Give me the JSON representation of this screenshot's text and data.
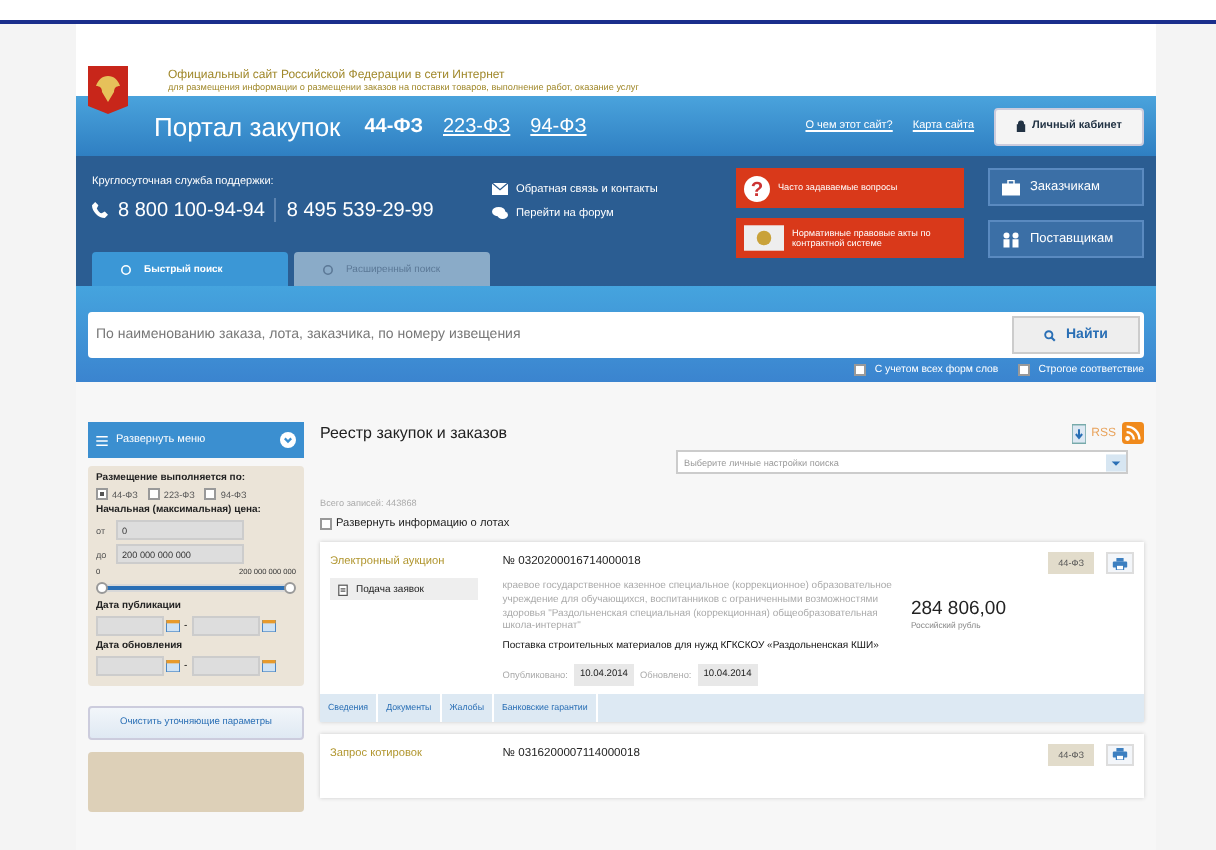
{
  "header": {
    "title": "Официальный сайт Российской Федерации в сети Интернет",
    "subtitle": "для размещения информации о размещении заказов на поставки товаров, выполнение работ, оказание услуг"
  },
  "nav": {
    "portal_title": "Портал закупок",
    "laws": [
      {
        "label": "44-ФЗ",
        "selected": true
      },
      {
        "label": "223-ФЗ",
        "selected": false
      },
      {
        "label": "94-ФЗ",
        "selected": false
      }
    ],
    "links": [
      "О чем этот сайт?",
      "Карта сайта"
    ],
    "cabinet_button": "Личный кабинет"
  },
  "support": {
    "label": "Круглосуточная служба поддержки:",
    "phones": [
      "8 800 100-94-94",
      "8 495 539-29-99"
    ]
  },
  "contact_links": [
    {
      "kind": "mail",
      "label": "Обратная связь и контакты"
    },
    {
      "kind": "forum",
      "label": "Перейти на форум"
    }
  ],
  "red_buttons": [
    {
      "kind": "faq",
      "icon": "?",
      "label": "Часто задаваемые вопросы"
    },
    {
      "kind": "law",
      "label": "Нормативные правовые акты по контрактной системе"
    }
  ],
  "blue_buttons": [
    {
      "kind": "customers",
      "label": "Заказчикам"
    },
    {
      "kind": "suppliers",
      "label": "Поставщикам"
    }
  ],
  "search_tabs": [
    {
      "label": "Быстрый поиск",
      "selected": true
    },
    {
      "label": "Расширенный поиск",
      "selected": false
    }
  ],
  "search": {
    "placeholder": "По наименованию заказа, лота, заказчика, по номеру извещения",
    "button": "Найти"
  },
  "search_options": [
    {
      "label": "С учетом всех форм слов",
      "checked": false
    },
    {
      "label": "Строгое соответствие",
      "checked": false
    }
  ],
  "sidebar": {
    "menu_button": "Развернуть меню",
    "placement_label": "Размещение выполняется по:",
    "laws": [
      {
        "label": "44-ФЗ",
        "checked": true
      },
      {
        "label": "223-ФЗ",
        "checked": false
      },
      {
        "label": "94-ФЗ",
        "checked": false
      }
    ],
    "price_label": "Начальная (максимальная) цена:",
    "from_label": "от",
    "from_value": "0",
    "to_label": "до",
    "to_value": "200 000 000 000",
    "range_min": "0",
    "range_max": "200 000 000 000",
    "level": 1,
    "pub_label": "Дата публикации",
    "upd_label": "Дата обновления",
    "date_separator": "-",
    "clear_button": "Очистить уточняющие параметры"
  },
  "registry": {
    "title": "Реестр закупок и заказов",
    "rss": "RSS",
    "settings_placeholder": "Выберите личные настройки поиска",
    "total": "Всего записей: 443868",
    "expand_lots": {
      "label": "Развернуть информацию о лотах",
      "checked": false
    }
  },
  "notices": [
    {
      "type": "Электронный аукцион",
      "stage": "Подача заявок",
      "number": "№ 0320200016714000018",
      "law": "44-ФЗ",
      "customer": "краевое государственное казенное специальное (коррекционное) образовательное учреждение для обучающихся, воспитанников с ограниченными возможностями здоровья \"Раздольненская специальная (коррекционная) общеобразовательная школа-интернат\"",
      "subject": "Поставка строительных материалов для нужд КГКСКОУ «Раздольненская КШИ»",
      "price": "284 806,00",
      "currency": "Российский рубль",
      "published_label": "Опубликовано:",
      "published": "10.04.2014",
      "updated_label": "Обновлено:",
      "updated": "10.04.2014",
      "tabs": [
        "Сведения",
        "Документы",
        "Жалобы",
        "Банковские гарантии"
      ]
    },
    {
      "type": "Запрос котировок",
      "number": "№ 0316200007114000018",
      "law": "44-ФЗ"
    }
  ]
}
